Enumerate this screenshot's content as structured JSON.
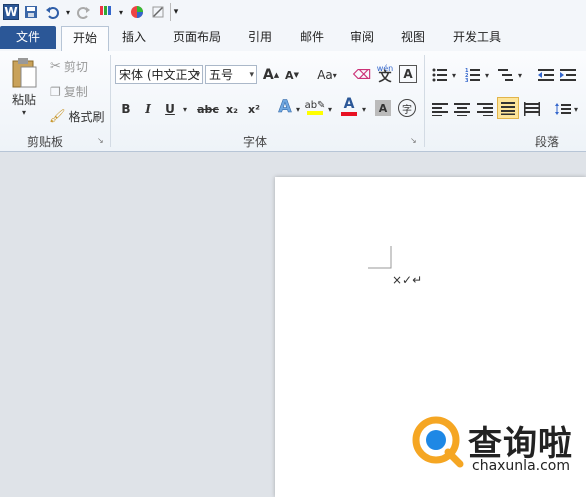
{
  "qat": {
    "word_logo": "W",
    "icons": [
      "save-icon",
      "undo-icon",
      "dropdown-arrow-icon",
      "redo-icon",
      "format-painter-icon",
      "color-wheel-icon",
      "draw-table-icon",
      "customize-qat-icon"
    ]
  },
  "tabs": [
    "文件",
    "开始",
    "插入",
    "页面布局",
    "引用",
    "邮件",
    "审阅",
    "视图",
    "开发工具"
  ],
  "clipboard": {
    "paste": "粘贴",
    "cut": "剪切",
    "copy": "复制",
    "format_painter": "格式刷",
    "group_label": "剪贴板"
  },
  "font": {
    "font_name": "宋体 (中文正文",
    "font_size": "五号",
    "grow": "A",
    "shrink": "A",
    "change_case": "Aa",
    "phonetic": "wén",
    "encircle": "字",
    "bold": "B",
    "italic": "I",
    "underline": "U",
    "strikethrough": "abc",
    "subscript": "x₂",
    "superscript": "x²",
    "highlight_color": "#ffff00",
    "font_color": "#e81123",
    "group_label": "字体"
  },
  "paragraph": {
    "group_label": "段落"
  },
  "document": {
    "text": "×✓↵"
  },
  "watermark": {
    "cn": "查询啦",
    "en": "chaxunla.com",
    "logo_color": "#f5a623",
    "logo_accent": "#1e88e5"
  }
}
